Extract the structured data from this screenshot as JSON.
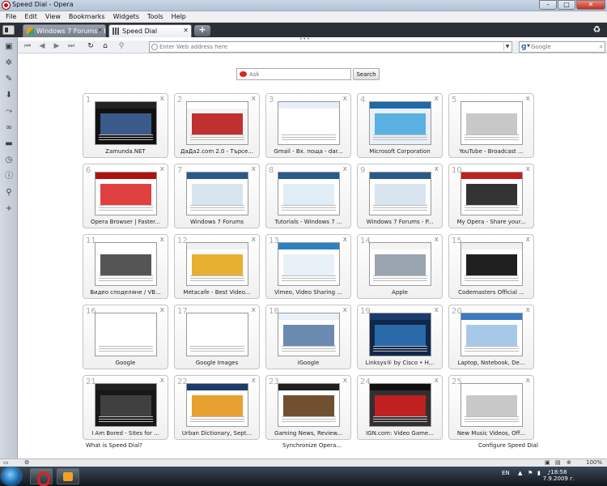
{
  "window": {
    "title": "Speed Dial - Opera",
    "min_label": "–",
    "max_label": "□",
    "close_label": "✕"
  },
  "menu": [
    "File",
    "Edit",
    "View",
    "Bookmarks",
    "Widgets",
    "Tools",
    "Help"
  ],
  "tabs": [
    {
      "label": "Windows 7 Forums - P...",
      "close": "✕"
    },
    {
      "label": "Speed Dial",
      "close": "✕"
    }
  ],
  "newtab_label": "+",
  "address": {
    "placeholder": "Enter Web address here"
  },
  "search": {
    "engine": "Google",
    "placeholder": "Google"
  },
  "speed_dial": {
    "search_placeholder": "Ask",
    "search_button": "Search",
    "dials": [
      {
        "num": "1",
        "label": "Zamunda.NET",
        "c1": "#222222",
        "c2": "#3a5a8a",
        "c3": "#111111"
      },
      {
        "num": "2",
        "label": "ДаДа2.com 2.0 - Търсе...",
        "c1": "#ffffff",
        "c2": "#c03030",
        "c3": "#f4f4f4"
      },
      {
        "num": "3",
        "label": "Gmail - Вх. поща - dar...",
        "c1": "#e8eef8",
        "c2": "#ffffff",
        "c3": "#ffffff"
      },
      {
        "num": "4",
        "label": "Microsoft Corporation",
        "c1": "#1e6aa8",
        "c2": "#5ab0e0",
        "c3": "#e8f0f8"
      },
      {
        "num": "5",
        "label": "YouTube - Broadcast ...",
        "c1": "#ffffff",
        "c2": "#c8c8c8",
        "c3": "#ffffff"
      },
      {
        "num": "6",
        "label": "Opera Browser | Faster...",
        "c1": "#b01010",
        "c2": "#e04040",
        "c3": "#ffffff"
      },
      {
        "num": "7",
        "label": "Windows 7 Forums",
        "c1": "#2a5a8a",
        "c2": "#d8e4f0",
        "c3": "#ffffff"
      },
      {
        "num": "8",
        "label": "Tutorials - Windows 7 ...",
        "c1": "#2a5a8a",
        "c2": "#e0ecf6",
        "c3": "#ffffff"
      },
      {
        "num": "9",
        "label": "Windows 7 Forums - P...",
        "c1": "#2a5a8a",
        "c2": "#d8e4f0",
        "c3": "#ffffff"
      },
      {
        "num": "10",
        "label": "My Opera - Share your...",
        "c1": "#c02020",
        "c2": "#333333",
        "c3": "#ffffff"
      },
      {
        "num": "11",
        "label": "Видео споделяне / VB...",
        "c1": "#ffffff",
        "c2": "#555555",
        "c3": "#ffffff"
      },
      {
        "num": "12",
        "label": "Metacafe - Best Video...",
        "c1": "#f0f0f0",
        "c2": "#e8b030",
        "c3": "#ffffff"
      },
      {
        "num": "13",
        "label": "Vimeo, Video Sharing ...",
        "c1": "#3080c0",
        "c2": "#e8f0f8",
        "c3": "#ffffff"
      },
      {
        "num": "14",
        "label": "Apple",
        "c1": "#f4f4f4",
        "c2": "#9aa4b0",
        "c3": "#ffffff"
      },
      {
        "num": "15",
        "label": "Codemasters Official ...",
        "c1": "#f0f0f0",
        "c2": "#202020",
        "c3": "#ffffff"
      },
      {
        "num": "16",
        "label": "Google",
        "c1": "#ffffff",
        "c2": "#ffffff",
        "c3": "#ffffff"
      },
      {
        "num": "17",
        "label": "Google Images",
        "c1": "#ffffff",
        "c2": "#ffffff",
        "c3": "#ffffff"
      },
      {
        "num": "18",
        "label": "iGoogle",
        "c1": "#e8f0f8",
        "c2": "#6a8ab0",
        "c3": "#ffffff"
      },
      {
        "num": "19",
        "label": "Linksys® by Cisco • H...",
        "c1": "#1c3c6c",
        "c2": "#2a6aa8",
        "c3": "#10284c"
      },
      {
        "num": "20",
        "label": "Laptop, Notebook, De...",
        "c1": "#3a7ac0",
        "c2": "#a8c8e8",
        "c3": "#ffffff"
      },
      {
        "num": "21",
        "label": "I Am Bored - Sites for ...",
        "c1": "#202020",
        "c2": "#404040",
        "c3": "#181818"
      },
      {
        "num": "22",
        "label": "Urban Dictionary, Sept...",
        "c1": "#1c3c6c",
        "c2": "#e8a030",
        "c3": "#ffffff"
      },
      {
        "num": "23",
        "label": "Gaming News, Review...",
        "c1": "#202020",
        "c2": "#705030",
        "c3": "#ffffff"
      },
      {
        "num": "24",
        "label": "IGN.com: Video Game...",
        "c1": "#101010",
        "c2": "#c02020",
        "c3": "#303030"
      },
      {
        "num": "25",
        "label": "New Music Videos, Off...",
        "c1": "#ffffff",
        "c2": "#c8c8c8",
        "c3": "#ffffff"
      }
    ],
    "close_glyph": "x"
  },
  "footer": {
    "what_is": "What is Speed Dial?",
    "sync": "Synchronize Opera...",
    "configure": "Configure Speed Dial"
  },
  "status": {
    "zoom": "100%"
  },
  "taskbar": {
    "lang": "EN",
    "time": "18:58",
    "date": "7.9.2009 г."
  }
}
